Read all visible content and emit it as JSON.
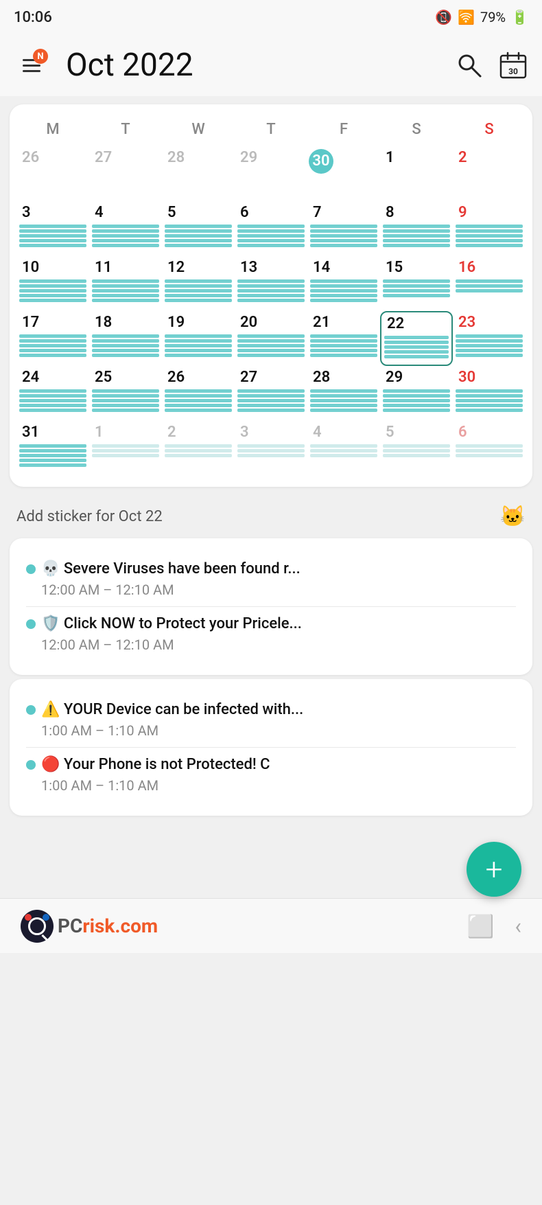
{
  "status": {
    "time": "10:06",
    "battery": "79%"
  },
  "header": {
    "title": "Oct  2022",
    "badge": "N",
    "search_label": "search",
    "calendar_label": "calendar"
  },
  "calendar": {
    "day_headers": [
      "M",
      "T",
      "W",
      "T",
      "F",
      "S",
      "S"
    ],
    "weeks": [
      [
        {
          "num": "26",
          "type": "other"
        },
        {
          "num": "27",
          "type": "other"
        },
        {
          "num": "28",
          "type": "other"
        },
        {
          "num": "29",
          "type": "other"
        },
        {
          "num": "30",
          "type": "today"
        },
        {
          "num": "1",
          "type": "normal"
        },
        {
          "num": "2",
          "type": "sunday"
        }
      ],
      [
        {
          "num": "3",
          "type": "normal",
          "bars": 5
        },
        {
          "num": "4",
          "type": "normal",
          "bars": 5
        },
        {
          "num": "5",
          "type": "normal",
          "bars": 5
        },
        {
          "num": "6",
          "type": "normal",
          "bars": 5
        },
        {
          "num": "7",
          "type": "normal",
          "bars": 5
        },
        {
          "num": "8",
          "type": "normal",
          "bars": 5
        },
        {
          "num": "9",
          "type": "sunday",
          "bars": 5
        }
      ],
      [
        {
          "num": "10",
          "type": "normal",
          "bars": 5
        },
        {
          "num": "11",
          "type": "normal",
          "bars": 5
        },
        {
          "num": "12",
          "type": "normal",
          "bars": 5
        },
        {
          "num": "13",
          "type": "normal",
          "bars": 5
        },
        {
          "num": "14",
          "type": "normal",
          "bars": 5
        },
        {
          "num": "15",
          "type": "normal",
          "bars": 4
        },
        {
          "num": "16",
          "type": "sunday",
          "bars": 3
        }
      ],
      [
        {
          "num": "17",
          "type": "normal",
          "bars": 5
        },
        {
          "num": "18",
          "type": "normal",
          "bars": 5
        },
        {
          "num": "19",
          "type": "normal",
          "bars": 5
        },
        {
          "num": "20",
          "type": "normal",
          "bars": 5
        },
        {
          "num": "21",
          "type": "normal",
          "bars": 5
        },
        {
          "num": "22",
          "type": "selected",
          "bars": 5
        },
        {
          "num": "23",
          "type": "sunday",
          "bars": 5
        }
      ],
      [
        {
          "num": "24",
          "type": "normal",
          "bars": 5
        },
        {
          "num": "25",
          "type": "normal",
          "bars": 5
        },
        {
          "num": "26",
          "type": "normal",
          "bars": 5
        },
        {
          "num": "27",
          "type": "normal",
          "bars": 5
        },
        {
          "num": "28",
          "type": "normal",
          "bars": 5
        },
        {
          "num": "29",
          "type": "normal",
          "bars": 5
        },
        {
          "num": "30",
          "type": "sunday",
          "bars": 5
        }
      ],
      [
        {
          "num": "31",
          "type": "normal",
          "bars": 5
        },
        {
          "num": "1",
          "type": "other",
          "bars": 3
        },
        {
          "num": "2",
          "type": "other",
          "bars": 3
        },
        {
          "num": "3",
          "type": "other",
          "bars": 3
        },
        {
          "num": "4",
          "type": "other",
          "bars": 3
        },
        {
          "num": "5",
          "type": "other",
          "bars": 3
        },
        {
          "num": "6",
          "type": "other-sunday",
          "bars": 3
        }
      ]
    ]
  },
  "sticker": {
    "text": "Add sticker for Oct 22"
  },
  "events": {
    "card1": [
      {
        "title": "💀 Severe Viruses have been found r...",
        "time": "12:00 AM – 12:10 AM"
      },
      {
        "title": "🛡️ Click NOW to Protect your Pricele...",
        "time": "12:00 AM – 12:10 AM"
      }
    ],
    "card2": [
      {
        "title": "⚠️ YOUR Device can be infected with...",
        "time": "1:00 AM – 1:10 AM"
      },
      {
        "title": "🔴 Your Phone is not Protected! C",
        "time": "1:00 AM – 1:10 AM"
      }
    ]
  },
  "fab": {
    "label": "+"
  },
  "bottom": {
    "logo_pc": "PC",
    "logo_risk": "risk",
    "logo_com": ".com"
  }
}
